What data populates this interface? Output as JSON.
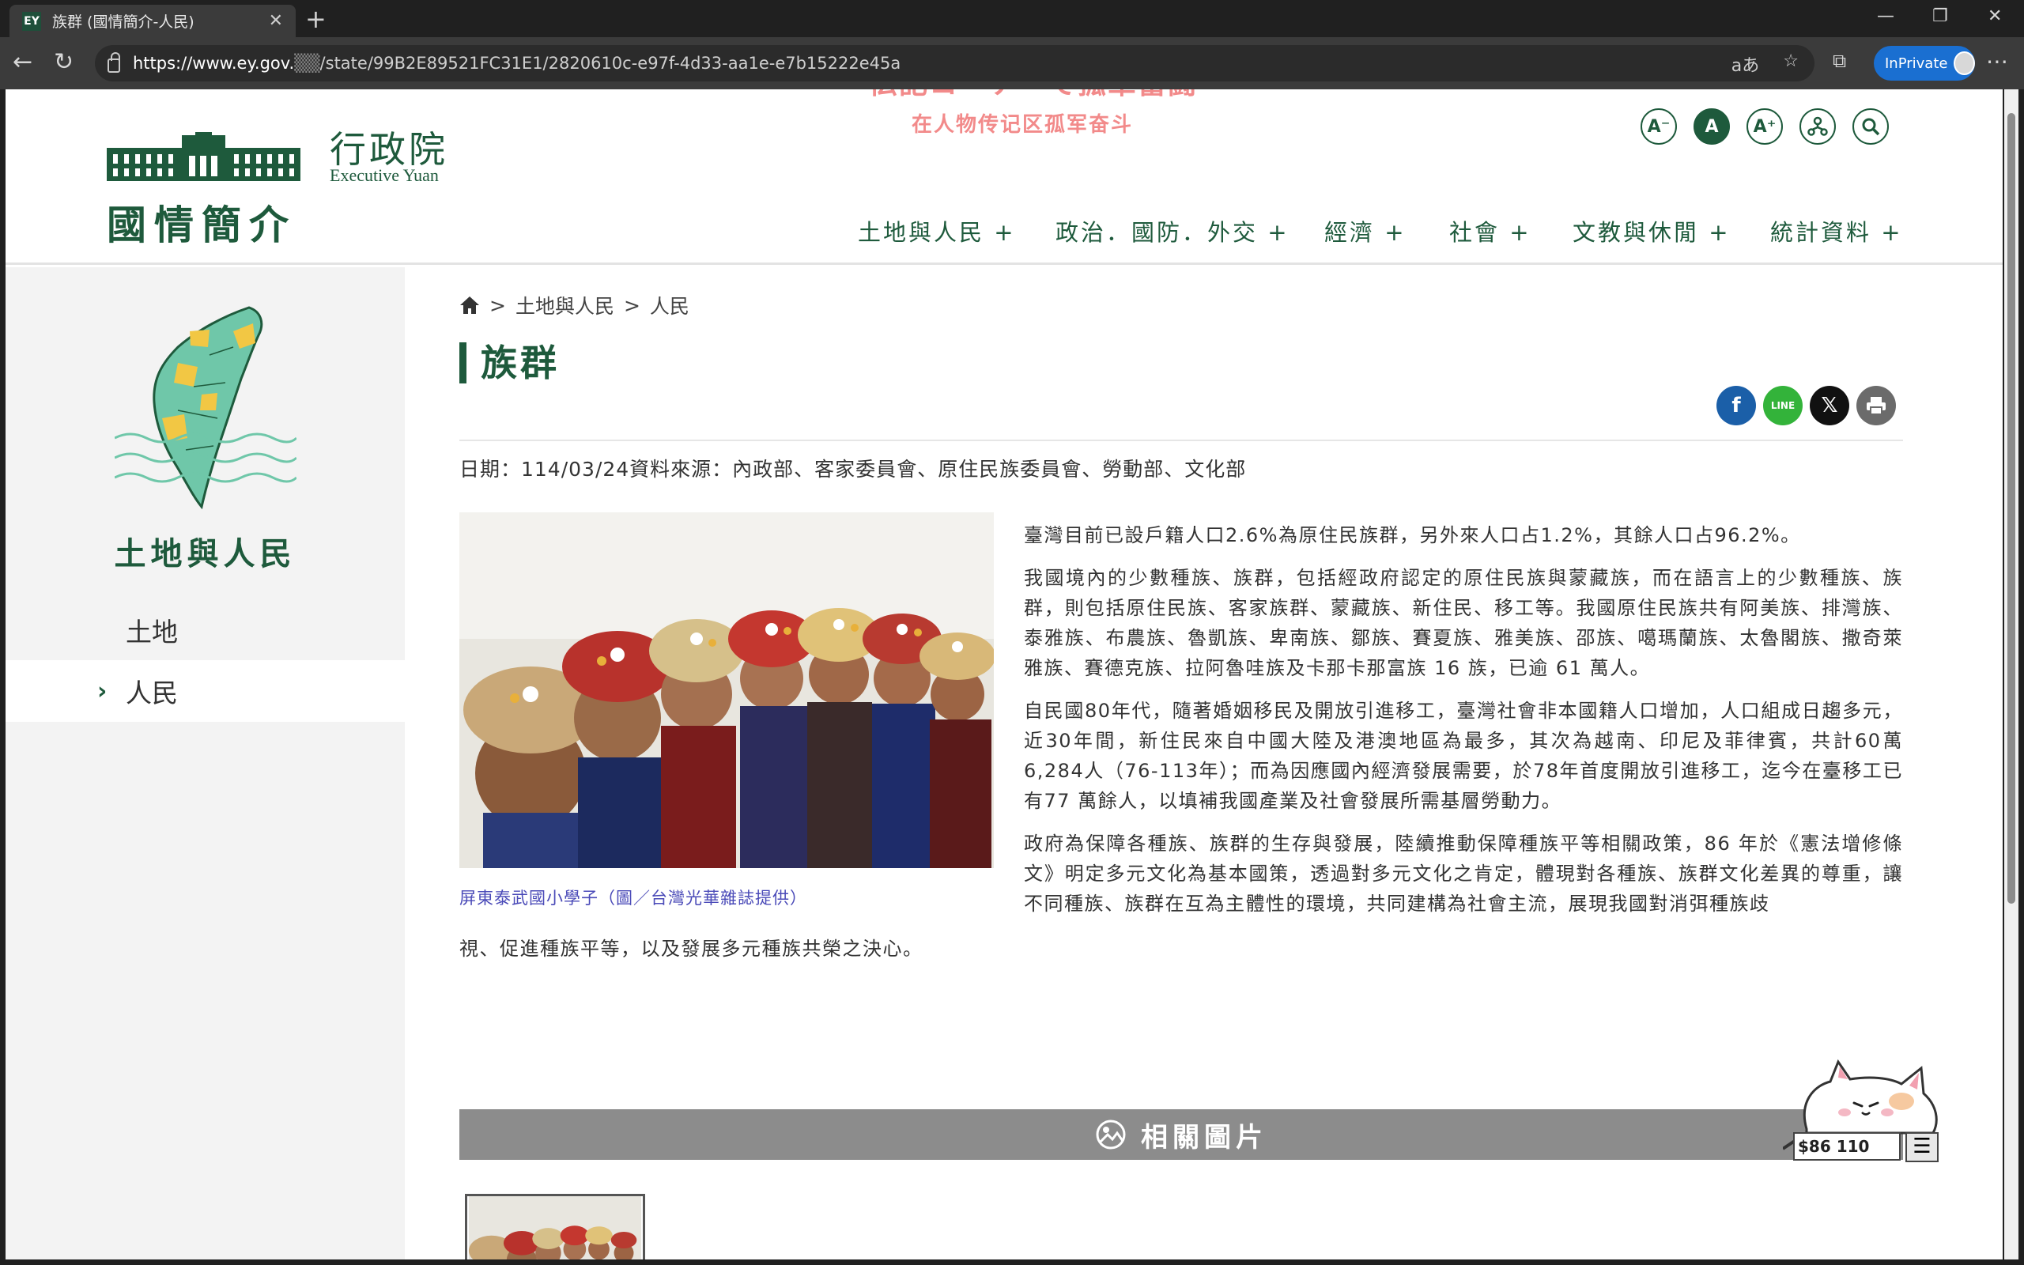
{
  "browser": {
    "tab_title": "族群 (國情簡介-人民)",
    "url_prefix": "https://www.ey.gov.",
    "url_rest": "/state/99B2E89521FC31E1/2820610c-e97f-4d33-aa1e-e7b15222e45a",
    "inprivate": "InPrivate"
  },
  "header": {
    "logo_cn": "行政院",
    "logo_en": "Executive Yuan",
    "site_title": "國情簡介",
    "overlay_jp": "伝記コーナーで孤軍奮闘",
    "overlay_cn": "在人物传记区孤军奋斗",
    "font_tools": [
      "A⁻",
      "A",
      "A⁺"
    ],
    "nav": [
      "土地與人民 +",
      "政治．國防．外交 +",
      "經濟 +",
      "社會 +",
      "文教與休閒 +",
      "統計資料 +"
    ]
  },
  "sidebar": {
    "title": "土地與人民",
    "items": [
      {
        "label": "土地"
      },
      {
        "label": "人民"
      }
    ]
  },
  "main": {
    "breadcrumb": [
      "土地與人民",
      "人民"
    ],
    "breadcrumb_sep": ">",
    "title": "族群",
    "meta": "日期：114/03/24資料來源：內政部、客家委員會、原住民族委員會、勞動部、文化部",
    "caption": "屏東泰武國小學子（圖／台灣光華雜誌提供）",
    "paragraphs": [
      "臺灣目前已設戶籍人口2.6%為原住民族群，另外來人口占1.2%，其餘人口占96.2%。",
      "我國境內的少數種族、族群，包括經政府認定的原住民族與蒙藏族，而在語言上的少數種族、族群，則包括原住民族、客家族群、蒙藏族、新住民、移工等。我國原住民族共有阿美族、排灣族、泰雅族、布農族、魯凱族、卑南族、鄒族、賽夏族、雅美族、邵族、噶瑪蘭族、太魯閣族、撒奇萊雅族、賽德克族、拉阿魯哇族及卡那卡那富族 16 族，已逾 61 萬人。",
      "自民國80年代，隨著婚姻移民及開放引進移工，臺灣社會非本國籍人口增加，人口組成日趨多元，近30年間，新住民來自中國大陸及港澳地區為最多，其次為越南、印尼及菲律賓，共計60萬6,284人（76-113年）；而為因應國內經濟發展需要，於78年首度開放引進移工，迄今在臺移工已有77 萬餘人，以填補我國產業及社會發展所需基層勞動力。",
      "政府為保障各種族、族群的生存與發展，陸續推動保障種族平等相關政策，86 年於《憲法增修條文》明定多元文化為基本國策，透過對多元文化之肯定，體現對各種族、族群文化差異的尊重，讓不同種族、族群在互為主體性的環境，共同建構為社會主流，展現我國對消弭種族歧"
    ],
    "tail": "視、促進種族平等，以及發展多元種族共榮之決心。",
    "related_title": "相關圖片"
  },
  "widget": {
    "stock": "$86 110"
  }
}
